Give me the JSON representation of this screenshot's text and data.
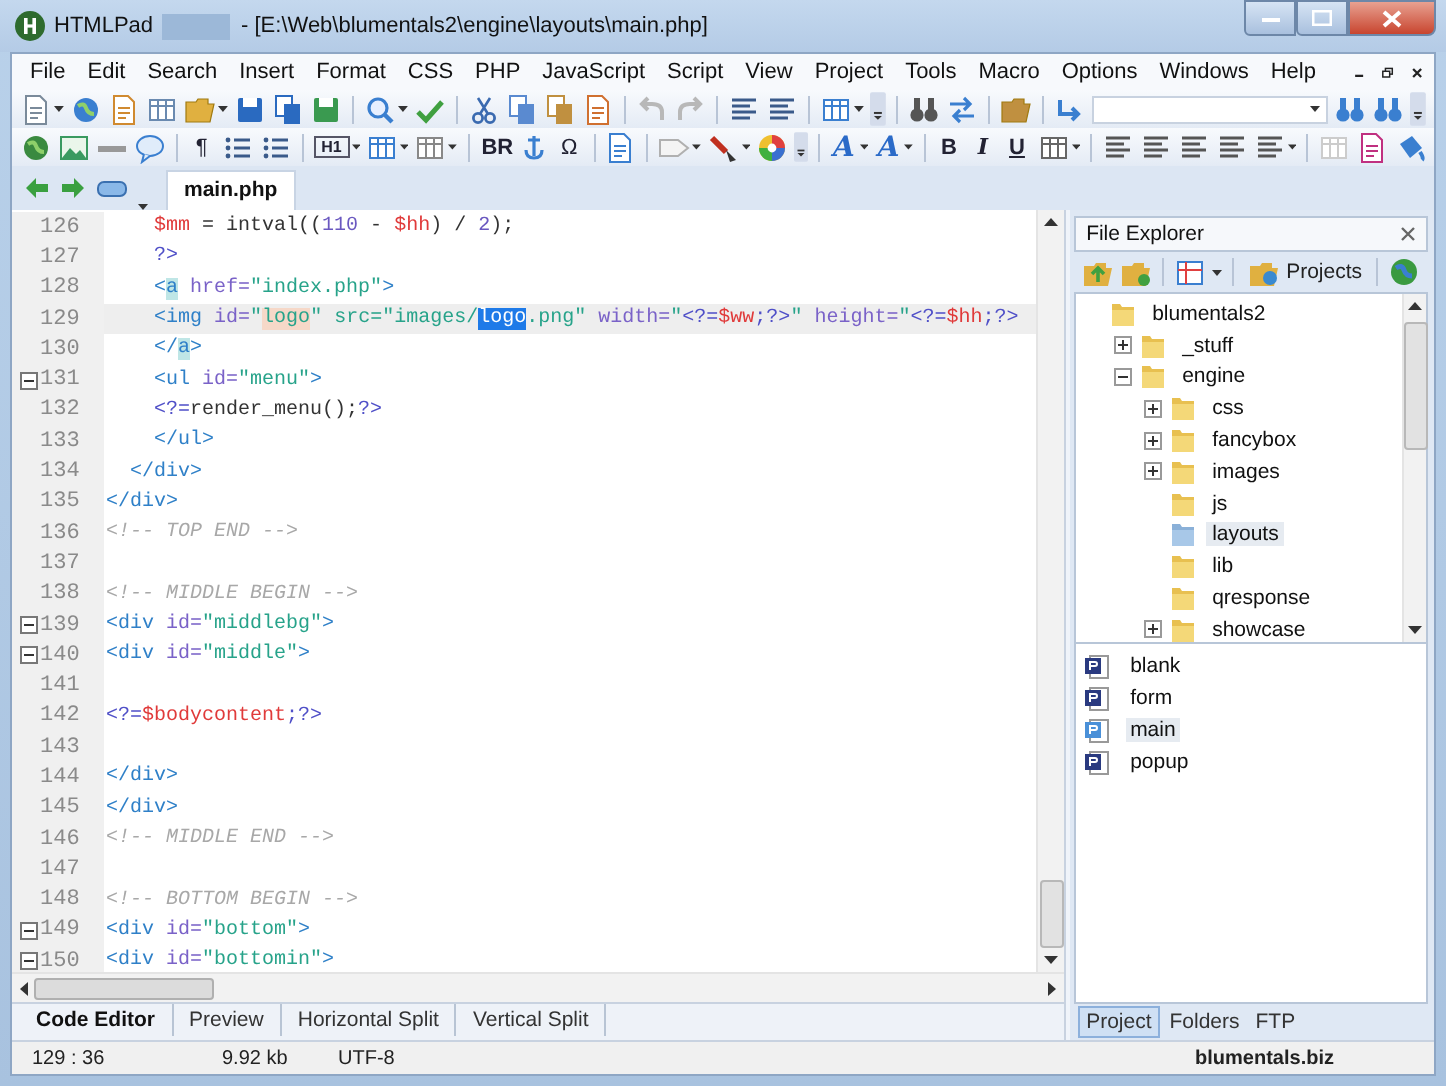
{
  "window": {
    "app_name": "HTMLPad",
    "title": "- [E:\\Web\\blumentals2\\engine\\layouts\\main.php]"
  },
  "menu": [
    "File",
    "Edit",
    "Search",
    "Insert",
    "Format",
    "CSS",
    "PHP",
    "JavaScript",
    "Script",
    "View",
    "Project",
    "Tools",
    "Macro",
    "Options",
    "Windows",
    "Help"
  ],
  "toolbar_labels": [
    {
      "label": "¶",
      "kind": "plain"
    },
    {
      "label": "H1",
      "kind": "boxed"
    },
    {
      "label": "BR",
      "kind": "bold"
    },
    {
      "label": "Ω",
      "kind": "plain"
    },
    {
      "label": "A",
      "kind": "fancy"
    },
    {
      "label": "A",
      "kind": "fancy"
    },
    {
      "label": "B",
      "kind": "bold"
    },
    {
      "label": "I",
      "kind": "italic"
    },
    {
      "label": "U",
      "kind": "underline"
    }
  ],
  "document_tabs": [
    {
      "label": "main.php",
      "selected": true
    }
  ],
  "editor": {
    "lines": [
      {
        "number": "126",
        "fold": false,
        "current": false,
        "tokens": [
          {
            "text": "    $mm",
            "kind": "var"
          },
          {
            "text": " = intval((",
            "kind": "txt"
          },
          {
            "text": "110",
            "kind": "num"
          },
          {
            "text": " - ",
            "kind": "txt"
          },
          {
            "text": "$hh",
            "kind": "var"
          },
          {
            "text": ") / ",
            "kind": "txt"
          },
          {
            "text": "2",
            "kind": "num"
          },
          {
            "text": ");",
            "kind": "txt"
          }
        ]
      },
      {
        "number": "127",
        "fold": false,
        "current": false,
        "tokens": [
          {
            "text": "    ?>",
            "kind": "php"
          }
        ]
      },
      {
        "number": "128",
        "fold": false,
        "current": false,
        "tokens": [
          {
            "text": "    <",
            "kind": "tag"
          },
          {
            "text": "a",
            "kind": "match"
          },
          {
            "text": " href=",
            "kind": "attr"
          },
          {
            "text": "\"index.php\"",
            "kind": "str"
          },
          {
            "text": ">",
            "kind": "tag"
          }
        ]
      },
      {
        "number": "129",
        "fold": false,
        "current": true,
        "tokens": [
          {
            "text": "    <img",
            "kind": "tag"
          },
          {
            "text": " id=",
            "kind": "attr"
          },
          {
            "text": "\"",
            "kind": "str"
          },
          {
            "text": "logo",
            "kind": "found"
          },
          {
            "text": "\" src=\"images/",
            "kind": "str"
          },
          {
            "text": "logo",
            "kind": "sel"
          },
          {
            "text": ".png\"",
            "kind": "str"
          },
          {
            "text": " width=",
            "kind": "attr"
          },
          {
            "text": "\"",
            "kind": "str"
          },
          {
            "text": "<?=",
            "kind": "php"
          },
          {
            "text": "$ww",
            "kind": "var"
          },
          {
            "text": ";?>",
            "kind": "php"
          },
          {
            "text": "\"",
            "kind": "str"
          },
          {
            "text": " height=",
            "kind": "attr"
          },
          {
            "text": "\"",
            "kind": "str"
          },
          {
            "text": "<?=",
            "kind": "php"
          },
          {
            "text": "$hh",
            "kind": "var"
          },
          {
            "text": ";?>",
            "kind": "php"
          }
        ]
      },
      {
        "number": "130",
        "fold": false,
        "current": false,
        "tokens": [
          {
            "text": "    </",
            "kind": "tag"
          },
          {
            "text": "a",
            "kind": "match"
          },
          {
            "text": ">",
            "kind": "tag"
          }
        ]
      },
      {
        "number": "131",
        "fold": true,
        "current": false,
        "tokens": [
          {
            "text": "    <ul",
            "kind": "tag"
          },
          {
            "text": " id=",
            "kind": "attr"
          },
          {
            "text": "\"menu\"",
            "kind": "str"
          },
          {
            "text": ">",
            "kind": "tag"
          }
        ]
      },
      {
        "number": "132",
        "fold": false,
        "current": false,
        "tokens": [
          {
            "text": "    <?=",
            "kind": "php"
          },
          {
            "text": "render_menu();",
            "kind": "txt"
          },
          {
            "text": "?>",
            "kind": "php"
          }
        ]
      },
      {
        "number": "133",
        "fold": false,
        "current": false,
        "tokens": [
          {
            "text": "    </ul>",
            "kind": "tag"
          }
        ]
      },
      {
        "number": "134",
        "fold": false,
        "current": false,
        "tokens": [
          {
            "text": "  </div>",
            "kind": "tag"
          }
        ]
      },
      {
        "number": "135",
        "fold": false,
        "current": false,
        "tokens": [
          {
            "text": "</div>",
            "kind": "tag"
          }
        ]
      },
      {
        "number": "136",
        "fold": false,
        "current": false,
        "tokens": [
          {
            "text": "<!-- TOP END -->",
            "kind": "cmt"
          }
        ]
      },
      {
        "number": "137",
        "fold": false,
        "current": false
      },
      {
        "number": "138",
        "fold": false,
        "current": false,
        "tokens": [
          {
            "text": "<!-- MIDDLE BEGIN -->",
            "kind": "cmt"
          }
        ]
      },
      {
        "number": "139",
        "fold": true,
        "current": false,
        "tokens": [
          {
            "text": "<div",
            "kind": "tag"
          },
          {
            "text": " id=",
            "kind": "attr"
          },
          {
            "text": "\"middlebg\"",
            "kind": "str"
          },
          {
            "text": ">",
            "kind": "tag"
          }
        ]
      },
      {
        "number": "140",
        "fold": true,
        "current": false,
        "tokens": [
          {
            "text": "<div",
            "kind": "tag"
          },
          {
            "text": " id=",
            "kind": "attr"
          },
          {
            "text": "\"middle\"",
            "kind": "str"
          },
          {
            "text": ">",
            "kind": "tag"
          }
        ]
      },
      {
        "number": "141",
        "fold": false,
        "current": false
      },
      {
        "number": "142",
        "fold": false,
        "current": false,
        "tokens": [
          {
            "text": "<?=",
            "kind": "php"
          },
          {
            "text": "$bodycontent",
            "kind": "var"
          },
          {
            "text": ";?>",
            "kind": "php"
          }
        ]
      },
      {
        "number": "143",
        "fold": false,
        "current": false
      },
      {
        "number": "144",
        "fold": false,
        "current": false,
        "tokens": [
          {
            "text": "</div>",
            "kind": "tag"
          }
        ]
      },
      {
        "number": "145",
        "fold": false,
        "current": false,
        "tokens": [
          {
            "text": "</div>",
            "kind": "tag"
          }
        ]
      },
      {
        "number": "146",
        "fold": false,
        "current": false,
        "tokens": [
          {
            "text": "<!-- MIDDLE END -->",
            "kind": "cmt"
          }
        ]
      },
      {
        "number": "147",
        "fold": false,
        "current": false
      },
      {
        "number": "148",
        "fold": false,
        "current": false,
        "tokens": [
          {
            "text": "<!-- BOTTOM BEGIN -->",
            "kind": "cmt"
          }
        ]
      },
      {
        "number": "149",
        "fold": true,
        "current": false,
        "tokens": [
          {
            "text": "<div",
            "kind": "tag"
          },
          {
            "text": " id=",
            "kind": "attr"
          },
          {
            "text": "\"bottom\"",
            "kind": "str"
          },
          {
            "text": ">",
            "kind": "tag"
          }
        ]
      },
      {
        "number": "150",
        "fold": true,
        "current": false,
        "tokens": [
          {
            "text": "<div",
            "kind": "tag"
          },
          {
            "text": " id=",
            "kind": "attr"
          },
          {
            "text": "\"bottomin\"",
            "kind": "str"
          },
          {
            "text": ">",
            "kind": "tag"
          }
        ]
      }
    ]
  },
  "editor_tabs": [
    {
      "label": "Code Editor",
      "selected": true
    },
    {
      "label": "Preview",
      "selected": false
    },
    {
      "label": "Horizontal Split",
      "selected": false
    },
    {
      "label": "Vertical Split",
      "selected": false
    }
  ],
  "status_bar": {
    "position": "129 : 36",
    "size": "9.92 kb",
    "encoding": "UTF-8"
  },
  "file_explorer": {
    "title": "File Explorer",
    "projects_button": "Projects",
    "tree": [
      {
        "label": "blumentals2",
        "selected": false,
        "children": [
          {
            "label": "_stuff",
            "kind": "collapsed",
            "selected": false
          },
          {
            "label": "engine",
            "kind": "expanded",
            "selected": false,
            "children": [
              {
                "label": "css",
                "kind": "collapsed",
                "selected": false
              },
              {
                "label": "fancybox",
                "kind": "collapsed",
                "selected": false
              },
              {
                "label": "images",
                "kind": "collapsed",
                "selected": false
              },
              {
                "label": "js",
                "kind": "leaf",
                "selected": false
              },
              {
                "label": "layouts",
                "kind": "leaf",
                "selected": true
              },
              {
                "label": "lib",
                "kind": "leaf",
                "selected": false
              },
              {
                "label": "qresponse",
                "kind": "leaf",
                "selected": false
              },
              {
                "label": "showcase",
                "kind": "collapsed",
                "selected": false
              }
            ]
          }
        ]
      }
    ],
    "files": [
      {
        "label": "blank",
        "selected": false
      },
      {
        "label": "form",
        "selected": false
      },
      {
        "label": "main",
        "selected": true
      },
      {
        "label": "popup",
        "selected": false
      }
    ],
    "tabs": [
      {
        "label": "Project",
        "selected": true
      },
      {
        "label": "Folders",
        "selected": false
      },
      {
        "label": "FTP",
        "selected": false
      }
    ],
    "status": "blumentals.biz"
  }
}
